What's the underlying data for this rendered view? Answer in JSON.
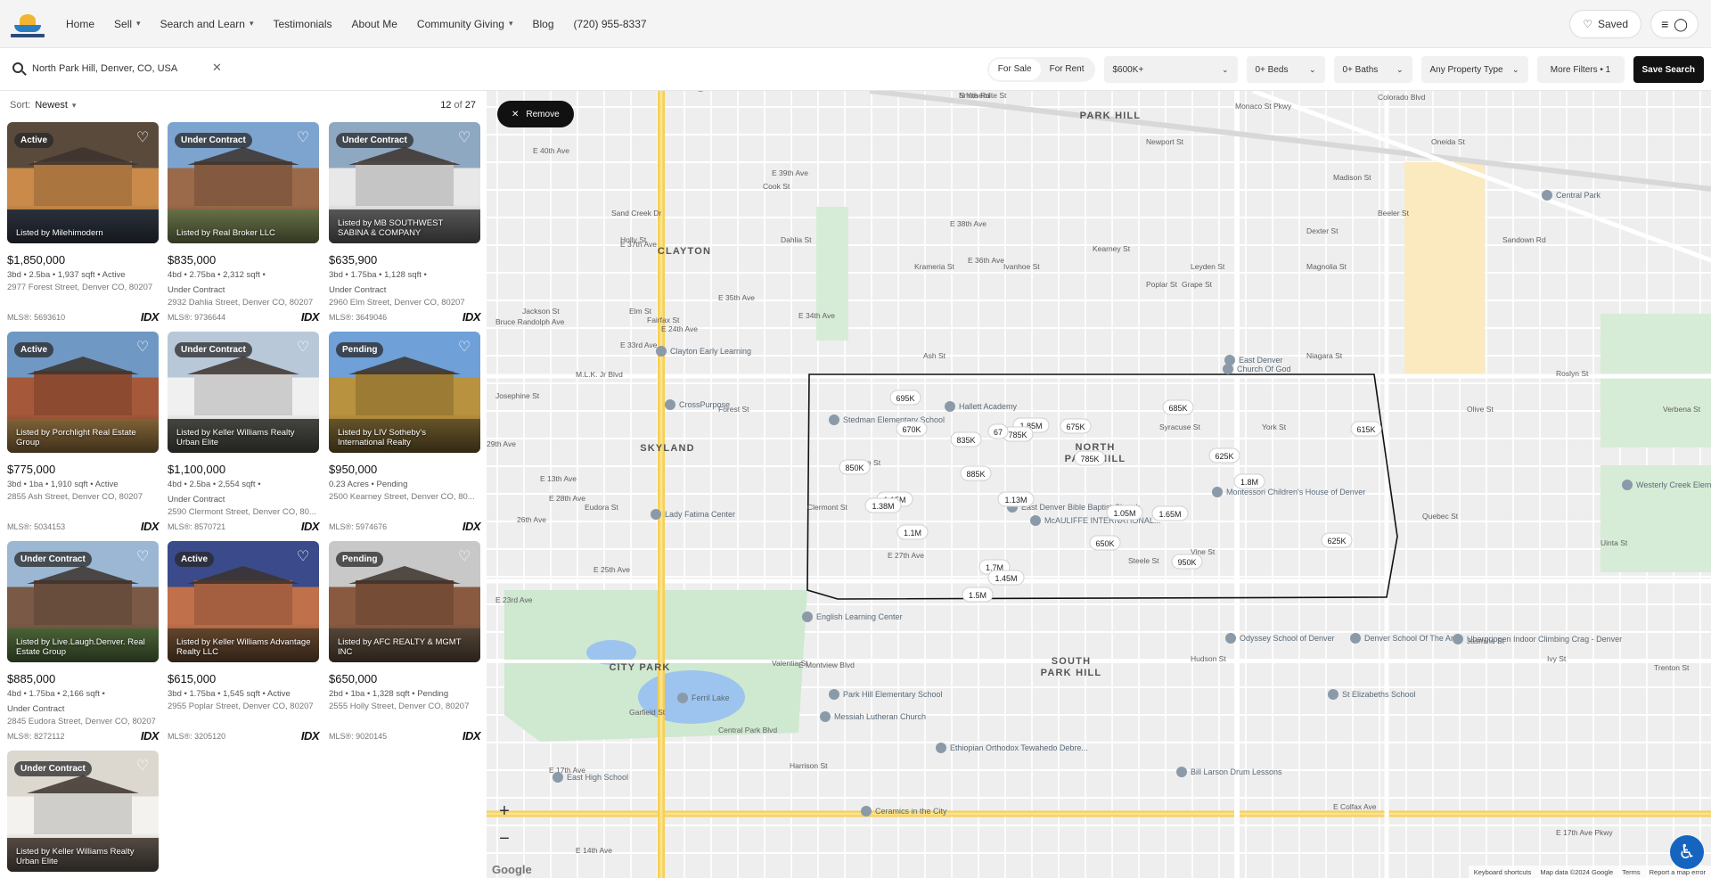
{
  "header": {
    "nav": [
      {
        "label": "Home",
        "dropdown": false
      },
      {
        "label": "Sell",
        "dropdown": true
      },
      {
        "label": "Search and Learn",
        "dropdown": true
      },
      {
        "label": "Testimonials",
        "dropdown": false
      },
      {
        "label": "About Me",
        "dropdown": false
      },
      {
        "label": "Community Giving",
        "dropdown": true
      },
      {
        "label": "Blog",
        "dropdown": false
      },
      {
        "label": "(720) 955-8337",
        "dropdown": false
      }
    ],
    "saved_label": "Saved"
  },
  "search": {
    "query": "North Park Hill, Denver, CO, USA",
    "mode_options": [
      "For Sale",
      "For Rent"
    ],
    "mode_selected": "For Sale",
    "price": "$600K+",
    "beds": "0+ Beds",
    "baths": "0+ Baths",
    "property_type": "Any Property Type",
    "more_filters": "More Filters • 1",
    "save_search": "Save Search"
  },
  "results": {
    "sort_label": "Sort:",
    "sort_value": "Newest",
    "count_shown": "12",
    "count_of": "of",
    "count_total": "27"
  },
  "listings": [
    {
      "status": "Active",
      "price": "$1,850,000",
      "stats": "3bd • 2.5ba • 1,937 sqft • Active",
      "status_line": "",
      "address": "2977 Forest Street, Denver CO, 80207",
      "listed_by": "Listed by Milehimodern",
      "mls": "MLS®: 5693610",
      "colors": [
        "#5a4a3c",
        "#c98a4a",
        "#2d3440"
      ]
    },
    {
      "status": "Under Contract",
      "price": "$835,000",
      "stats": "4bd • 2.75ba • 2,312 sqft •",
      "status_line": "Under Contract",
      "address": "2932 Dahlia Street, Denver CO, 80207",
      "listed_by": "Listed by Real Broker LLC",
      "mls": "MLS®: 9736644",
      "colors": [
        "#7da4cf",
        "#9a6a4a",
        "#6e7a4c"
      ]
    },
    {
      "status": "Under Contract",
      "price": "$635,900",
      "stats": "3bd • 1.75ba • 1,128 sqft •",
      "status_line": "Under Contract",
      "address": "2960 Elm Street, Denver CO, 80207",
      "listed_by": "Listed by MB SOUTHWEST SABINA & COMPANY",
      "mls": "MLS®: 3649046",
      "colors": [
        "#8fa8c2",
        "#e8e8e8",
        "#5d5d5d"
      ]
    },
    {
      "status": "Active",
      "price": "$775,000",
      "stats": "3bd • 1ba • 1,910 sqft • Active",
      "status_line": "",
      "address": "2855 Ash Street, Denver CO, 80207",
      "listed_by": "Listed by Porchlight Real Estate Group",
      "mls": "MLS®: 5034153",
      "colors": [
        "#6f98c4",
        "#a5583a",
        "#8a6a3a"
      ]
    },
    {
      "status": "Under Contract",
      "price": "$1,100,000",
      "stats": "4bd • 2.5ba • 2,554 sqft •",
      "status_line": "Under Contract",
      "address": "2590 Clermont Street, Denver CO, 80...",
      "listed_by": "Listed by Keller Williams Realty Urban Elite",
      "mls": "MLS®: 8570721",
      "colors": [
        "#b8c8d8",
        "#f0f0f0",
        "#4a4a44"
      ]
    },
    {
      "status": "Pending",
      "price": "$950,000",
      "stats": "0.23 Acres • Pending",
      "status_line": "",
      "address": "2500 Kearney Street, Denver CO, 80...",
      "listed_by": "Listed by LIV Sotheby's International Realty",
      "mls": "MLS®: 5974676",
      "colors": [
        "#6fa0d8",
        "#b8923e",
        "#6e5a2c"
      ]
    },
    {
      "status": "Under Contract",
      "price": "$885,000",
      "stats": "4bd • 1.75ba • 2,166 sqft •",
      "status_line": "Under Contract",
      "address": "2845 Eudora Street, Denver CO, 80207",
      "listed_by": "Listed by Live.Laugh.Denver. Real Estate Group",
      "mls": "MLS®: 8272112",
      "colors": [
        "#9bb7d4",
        "#7a5a46",
        "#4f6a3a"
      ]
    },
    {
      "status": "Active",
      "price": "$615,000",
      "stats": "3bd • 1.75ba • 1,545 sqft • Active",
      "status_line": "",
      "address": "2955 Poplar Street, Denver CO, 80207",
      "listed_by": "Listed by Keller Williams Advantage Realty LLC",
      "mls": "MLS®: 3205120",
      "colors": [
        "#3a4a8a",
        "#c0704a",
        "#6a4a30"
      ]
    },
    {
      "status": "Pending",
      "price": "$650,000",
      "stats": "2bd • 1ba • 1,328 sqft • Pending",
      "status_line": "",
      "address": "2555 Holly Street, Denver CO, 80207",
      "listed_by": "Listed by AFC REALTY & MGMT INC",
      "mls": "MLS®: 9020145",
      "colors": [
        "#c8c8c8",
        "#8a5a40",
        "#5a4a3a"
      ]
    },
    {
      "status": "Under Contract",
      "price": "",
      "stats": "",
      "status_line": "",
      "address": "",
      "listed_by": "Listed by Keller Williams Realty Urban Elite",
      "mls": "",
      "colors": [
        "#dcd8d0",
        "#f4f2ee",
        "#5a5048"
      ]
    }
  ],
  "map": {
    "remove_label": "Remove",
    "zoom_in": "+",
    "zoom_out": "−",
    "attribution": [
      "Keyboard shortcuts",
      "Map data ©2024 Google",
      "Terms",
      "Report a map error"
    ],
    "google_logo": "Google",
    "neighborhoods": [
      {
        "name": "PARK HILL"
      },
      {
        "name": "CLAYTON"
      },
      {
        "name": "SKYLAND"
      },
      {
        "name": "NORTH"
      },
      {
        "name": "PARK HILL"
      },
      {
        "name": "CITY PARK"
      },
      {
        "name": "SOUTH"
      },
      {
        "name": "PARK HILL"
      }
    ],
    "streets": [
      "Smith Rd",
      "E 40th Ave",
      "E 39th Ave",
      "E 38th Ave",
      "E 37th Ave",
      "E 36th Ave",
      "E 35th Ave",
      "E 34th Ave",
      "E 33rd Ave",
      "Bruce Randolph Ave",
      "M.L.K. Jr Blvd",
      "29th Ave",
      "26th Ave",
      "E 23rd Ave",
      "E Montview Blvd",
      "E 17th Ave",
      "E Colfax Ave",
      "E 14th Ave",
      "E 13th Ave",
      "E 28th Ave",
      "E 27th Ave",
      "E 25th Ave",
      "E 24th Ave",
      "Colorado Blvd",
      "Monaco St Pkwy",
      "Quebec St",
      "Syracuse St",
      "Kearney St",
      "Holly St",
      "Dahlia St",
      "Elm St",
      "Fairfax St",
      "Forest St",
      "Glencoe St",
      "Ash St",
      "Clermont St",
      "Eudora St",
      "Jackson St",
      "Garfield St",
      "York St",
      "Steele St",
      "Madison St",
      "Oneida St",
      "Newport St",
      "Poplar St",
      "Leyden St",
      "Sandown Rd",
      "Central Park Blvd",
      "E 17th Ave Pkwy",
      "Sand Creek Dr",
      "Cook St",
      "Fillmore St",
      "Josephine St",
      "Harrison St",
      "Vine St",
      "Niagara St",
      "Olive St",
      "Roslyn St",
      "Uinta St",
      "Valentia St",
      "Beeler St",
      "Dexter St",
      "Magnolia St",
      "Krameria St",
      "Ivanhoe St",
      "Grape St",
      "Hudson St",
      "Jasmine St",
      "Ivy St",
      "Trenton St",
      "Verbena St",
      "N Yosemite St"
    ],
    "places": [
      "40th & Colorado Station",
      "Church Of God",
      "East Denver",
      "Clayton Early Learning",
      "CrossPurpose",
      "Stedman Elementary School",
      "Hallett Academy",
      "Montessori Children's House of Denver",
      "East Denver Bible Baptist Church",
      "McAULIFFE INTERNATIONAL...",
      "Lady Fatima Center",
      "English Learning Center",
      "Odyssey School of Denver",
      "Denver School Of The Arts",
      "Ubergrippen Indoor Climbing Crag - Denver",
      "Westerly Creek Elementary School",
      "Park Hill Elementary School",
      "St Elizabeths School",
      "Messiah Lutheran Church",
      "Ethiopian Orthodox Tewahedo Debre...",
      "East High School",
      "Bill Larson Drum Lessons",
      "Ceramics in the City",
      "Central Park",
      "Ferril Lake"
    ],
    "price_pins": [
      {
        "label": "695K"
      },
      {
        "label": "670K"
      },
      {
        "label": "835K"
      },
      {
        "label": "1.85M"
      },
      {
        "label": "785K"
      },
      {
        "label": "67"
      },
      {
        "label": "675K"
      },
      {
        "label": "685K"
      },
      {
        "label": "615K"
      },
      {
        "label": "850K"
      },
      {
        "label": "885K"
      },
      {
        "label": "625K"
      },
      {
        "label": "785K"
      },
      {
        "label": "1.8M"
      },
      {
        "label": "1.15M"
      },
      {
        "label": "1.38M"
      },
      {
        "label": "1.13M"
      },
      {
        "label": "1.05M"
      },
      {
        "label": "1.65M"
      },
      {
        "label": "1.1M"
      },
      {
        "label": "650K"
      },
      {
        "label": "625K"
      },
      {
        "label": "950K"
      },
      {
        "label": "1.7M"
      },
      {
        "label": "1.45M"
      },
      {
        "label": "1.5M"
      }
    ]
  }
}
